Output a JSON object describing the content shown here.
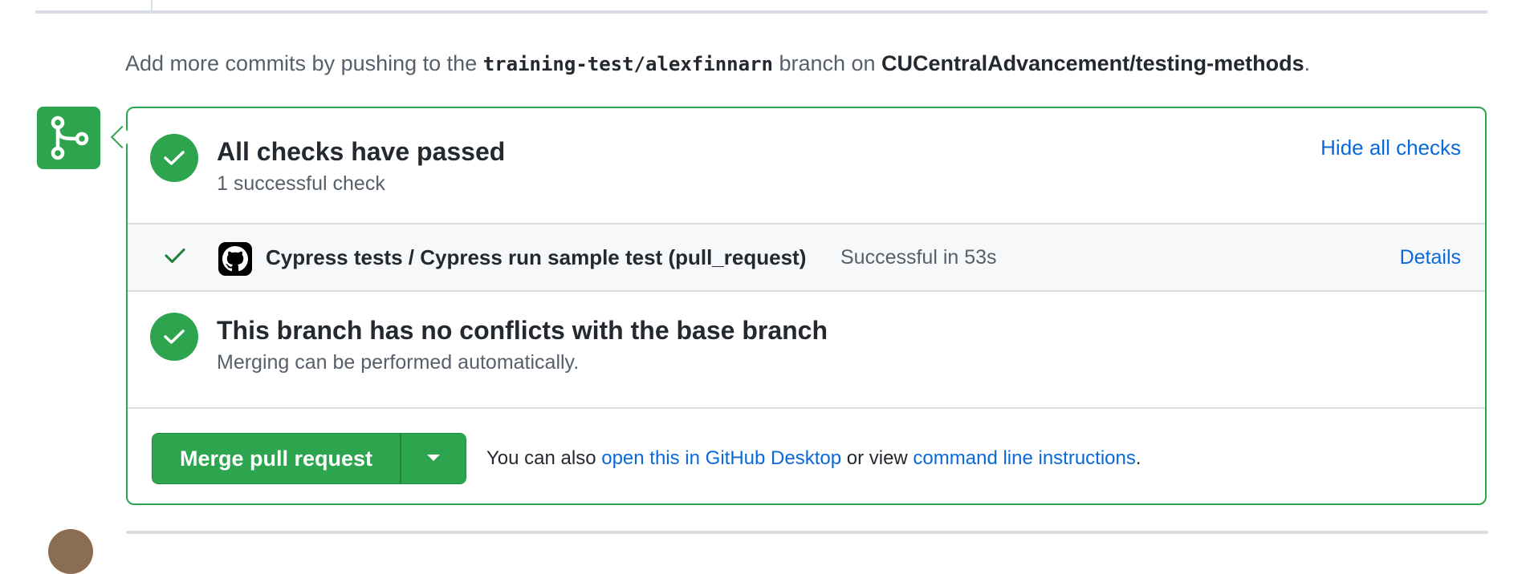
{
  "hint": {
    "prefix": "Add more commits by pushing to the ",
    "branch": "training-test/alexfinnarn",
    "middle": " branch on ",
    "repo": "CUCentralAdvancement/testing-methods",
    "suffix": "."
  },
  "checks_summary": {
    "title": "All checks have passed",
    "subtitle": "1 successful check",
    "toggle_label": "Hide all checks"
  },
  "check_items": [
    {
      "name": "Cypress tests / Cypress run sample test (pull_request)",
      "status": "Successful in 53s",
      "details_label": "Details",
      "icon": "github-icon"
    }
  ],
  "conflicts": {
    "title": "This branch has no conflicts with the base branch",
    "subtitle": "Merging can be performed automatically."
  },
  "merge": {
    "button_label": "Merge pull request",
    "also_prefix": "You can also ",
    "desktop_link": "open this in GitHub Desktop",
    "also_middle": " or view ",
    "cli_link": "command line instructions",
    "also_suffix": "."
  },
  "colors": {
    "success": "#2da44e",
    "link": "#0969da",
    "muted": "#57606a"
  }
}
